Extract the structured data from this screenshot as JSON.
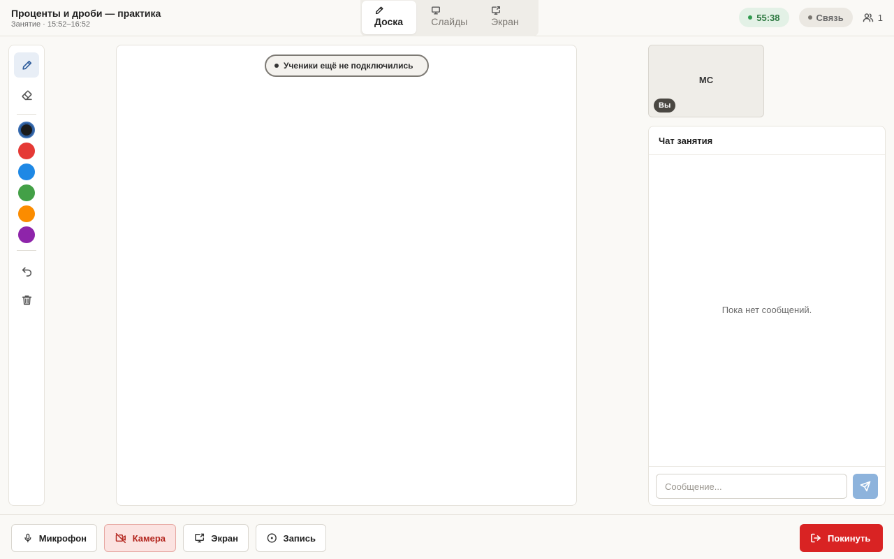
{
  "header": {
    "title": "Проценты и дроби — практика",
    "subtitle": "Занятие · 15:52–16:52",
    "tabs": [
      {
        "label": "Доска",
        "icon": "pencil-icon",
        "active": true
      },
      {
        "label": "Слайды",
        "icon": "presentation-icon",
        "active": false
      },
      {
        "label": "Экран",
        "icon": "screen-share-icon",
        "active": false
      }
    ],
    "timer": "55:38",
    "connection": "Связь",
    "participants_count": "1"
  },
  "toolbar": {
    "tools": [
      {
        "name": "pen",
        "icon": "pencil-icon",
        "active": true
      },
      {
        "name": "eraser",
        "icon": "eraser-icon",
        "active": false
      }
    ],
    "colors": [
      "#1a1a1a",
      "#e53935",
      "#1e88e5",
      "#43a047",
      "#fb8c00",
      "#8e24aa"
    ],
    "selected_color": "#1a1a1a",
    "actions": [
      {
        "name": "undo",
        "icon": "undo-icon"
      },
      {
        "name": "clear",
        "icon": "trash-icon"
      }
    ]
  },
  "board": {
    "notice": "Ученики ещё не подключились"
  },
  "video": {
    "initials": "МС",
    "badge": "Вы"
  },
  "chat": {
    "title": "Чат занятия",
    "empty_text": "Пока нет сообщений.",
    "input_placeholder": "Сообщение...",
    "send_icon": "send-icon"
  },
  "controls": {
    "mic_label": "Микрофон",
    "camera_label": "Камера",
    "screen_label": "Экран",
    "record_label": "Запись",
    "leave_label": "Покинуть"
  },
  "colors": {
    "accent": "#2d5b9a",
    "timer_green": "#2f7a42",
    "danger": "#d92323",
    "camera_off_bg": "#fbe3e1"
  }
}
